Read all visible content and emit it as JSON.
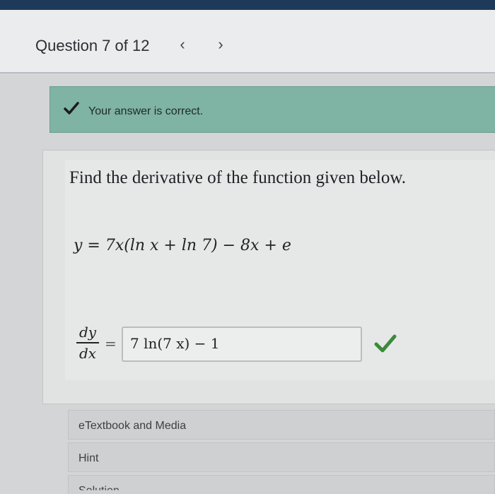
{
  "header": {
    "question_label": "Question 7 of 12",
    "prev_glyph": "‹",
    "next_glyph": "›"
  },
  "banner": {
    "message": "Your answer is correct.",
    "icon": "checkmark-icon",
    "color": "#7fb3a3"
  },
  "problem": {
    "prompt": "Find the derivative of the function given below.",
    "function": "y = 7x(ln x + ln 7) − 8x + e",
    "fraction_numerator": "dy",
    "fraction_denominator": "dx",
    "equals": "=",
    "answer_value": "7 ln(7 x) − 1",
    "correct_icon": "correct-check-icon",
    "correct_color": "#3a8a3a"
  },
  "sections": {
    "etextbook": "eTextbook and Media",
    "hint": "Hint",
    "solution": "Solution"
  }
}
